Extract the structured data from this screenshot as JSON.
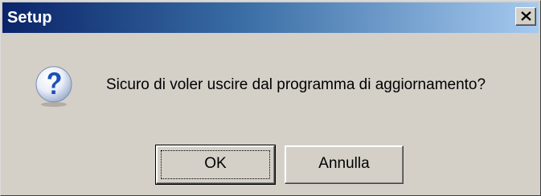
{
  "window": {
    "title": "Setup",
    "close_icon": "close-icon"
  },
  "dialog": {
    "icon": "question-icon",
    "message": "Sicuro di voler uscire dal programma di aggiornamento?"
  },
  "buttons": {
    "ok_label": "OK",
    "cancel_label": "Annulla"
  },
  "colors": {
    "titlebar_start": "#0a246a",
    "titlebar_end": "#a6caf0",
    "dialog_background": "#d4d0c8",
    "icon_blue": "#1c4fb8"
  }
}
